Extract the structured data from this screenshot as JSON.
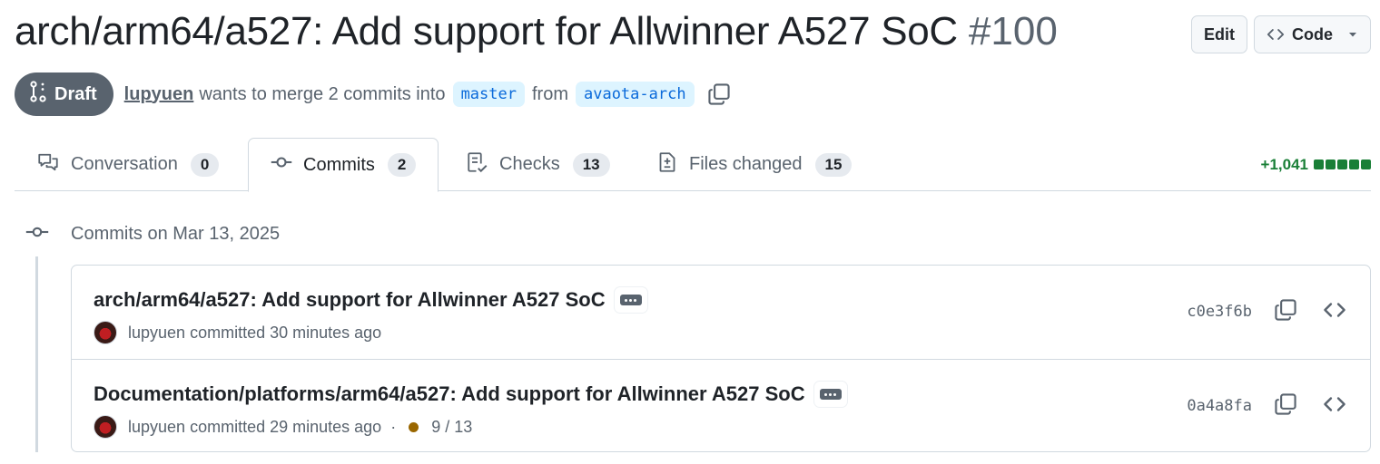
{
  "header": {
    "title": "arch/arm64/a527: Add support for Allwinner A527 SoC",
    "number": "#100",
    "edit_label": "Edit",
    "code_label": "Code"
  },
  "meta": {
    "state_label": "Draft",
    "author": "lupyuen",
    "merge_text": "wants to merge 2 commits into",
    "base_branch": "master",
    "from_text": "from",
    "head_branch": "avaota-arch"
  },
  "tabs": [
    {
      "label": "Conversation",
      "count": "0",
      "icon": "comment-discussion-icon",
      "active": false
    },
    {
      "label": "Commits",
      "count": "2",
      "icon": "git-commit-icon",
      "active": true
    },
    {
      "label": "Checks",
      "count": "13",
      "icon": "checklist-icon",
      "active": false
    },
    {
      "label": "Files changed",
      "count": "15",
      "icon": "file-diff-icon",
      "active": false
    }
  ],
  "diffstat": {
    "additions": "+1,041",
    "color": "#1a7f37"
  },
  "commits_group": {
    "label": "Commits on Mar 13, 2025",
    "commits": [
      {
        "title": "arch/arm64/a527: Add support for Allwinner A527 SoC",
        "author": "lupyuen",
        "time_text": "committed 30 minutes ago",
        "status": "",
        "sha": "c0e3f6b"
      },
      {
        "title": "Documentation/platforms/arm64/a527: Add support for Allwinner A527 SoC",
        "author": "lupyuen",
        "time_text": "committed 29 minutes ago",
        "status": "9 / 13",
        "sha": "0a4a8fa"
      }
    ]
  },
  "colors": {
    "accent": "#0969da",
    "branch_bg": "#ddf4ff",
    "draft_bg": "#59636e",
    "pending": "#9a6700"
  }
}
